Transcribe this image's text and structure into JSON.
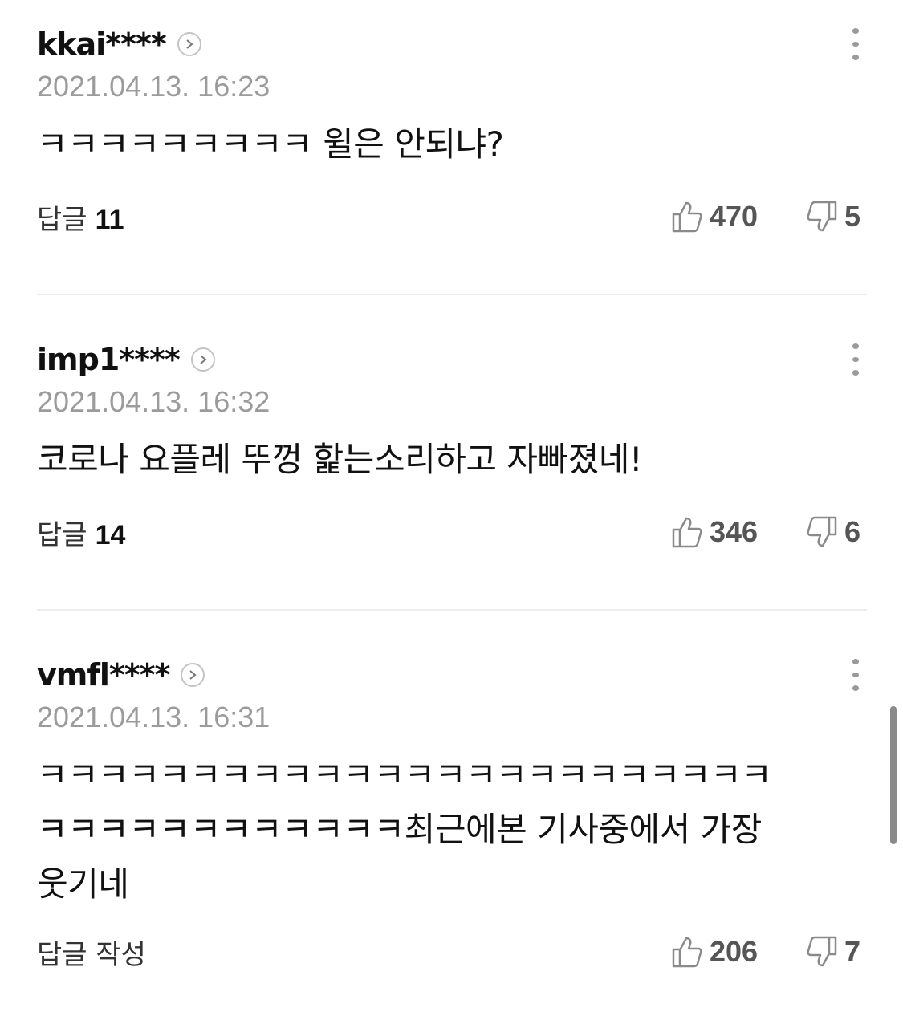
{
  "comments": [
    {
      "username": "kkai****",
      "date": "2021.04.13. 16:23",
      "lines": [
        "ㅋㅋㅋㅋㅋㅋㅋㅋㅋ 윌은 안되냐?"
      ],
      "reply_label": "답글",
      "reply_count": "11",
      "likes": "470",
      "dislikes": "5"
    },
    {
      "username": "imp1****",
      "date": "2021.04.13. 16:32",
      "lines": [
        "코로나 요플레 뚜껑 핥는소리하고 자빠졌네!"
      ],
      "reply_label": "답글",
      "reply_count": "14",
      "likes": "346",
      "dislikes": "6"
    },
    {
      "username": "vmfl****",
      "date": "2021.04.13. 16:31",
      "lines": [
        "ㅋㅋㅋㅋㅋㅋㅋㅋㅋㅋㅋㅋㅋㅋㅋㅋㅋㅋㅋㅋㅋㅋㅋㅋ",
        "ㅋㅋㅋㅋㅋㅋㅋㅋㅋㅋㅋㅋ최근에본 기사중에서 가장",
        "웃기네"
      ],
      "reply_label": "답글 작성",
      "reply_count": "",
      "likes": "206",
      "dislikes": "7"
    }
  ],
  "icons": {
    "profile": "chevron-right-circle-icon",
    "more": "more-vertical-icon",
    "like": "thumbs-up-icon",
    "dislike": "thumbs-down-icon"
  },
  "colors": {
    "text": "#111111",
    "muted": "#9b9b9b",
    "divider": "#ececec",
    "icon": "#8a8a8a"
  }
}
